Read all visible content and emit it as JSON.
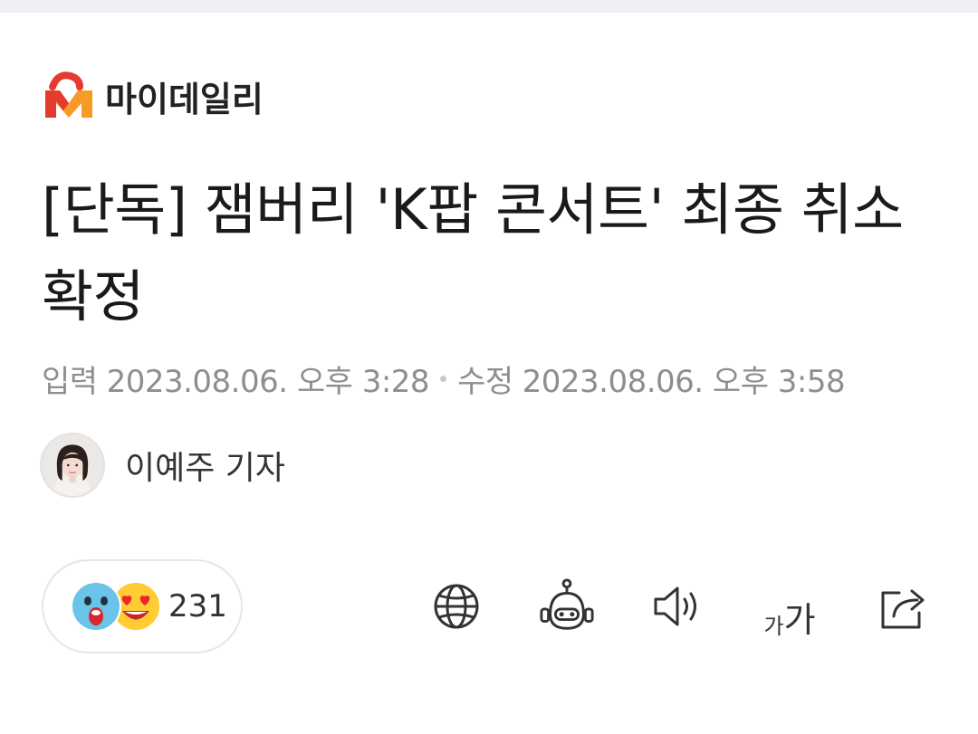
{
  "brand": {
    "name": "마이데일리",
    "colors": {
      "red": "#e53a2f",
      "orange": "#f79a26"
    }
  },
  "article": {
    "headline": "[단독] 잼버리 'K팝 콘서트' 최종 취소 확정",
    "published_label": "입력",
    "published": "2023.08.06. 오후 3:28",
    "modified_label": "수정",
    "modified": "2023.08.06. 오후 3:58"
  },
  "reporter": {
    "name": "이예주 기자"
  },
  "reactions": {
    "count": "231",
    "emojis": [
      "surprised-face-icon",
      "heart-eyes-face-icon"
    ]
  },
  "toolbar": {
    "icons": [
      "globe-icon",
      "robot-icon",
      "speaker-icon",
      "font-size-icon",
      "share-icon"
    ],
    "font_size_small": "가",
    "font_size_large": "가"
  }
}
